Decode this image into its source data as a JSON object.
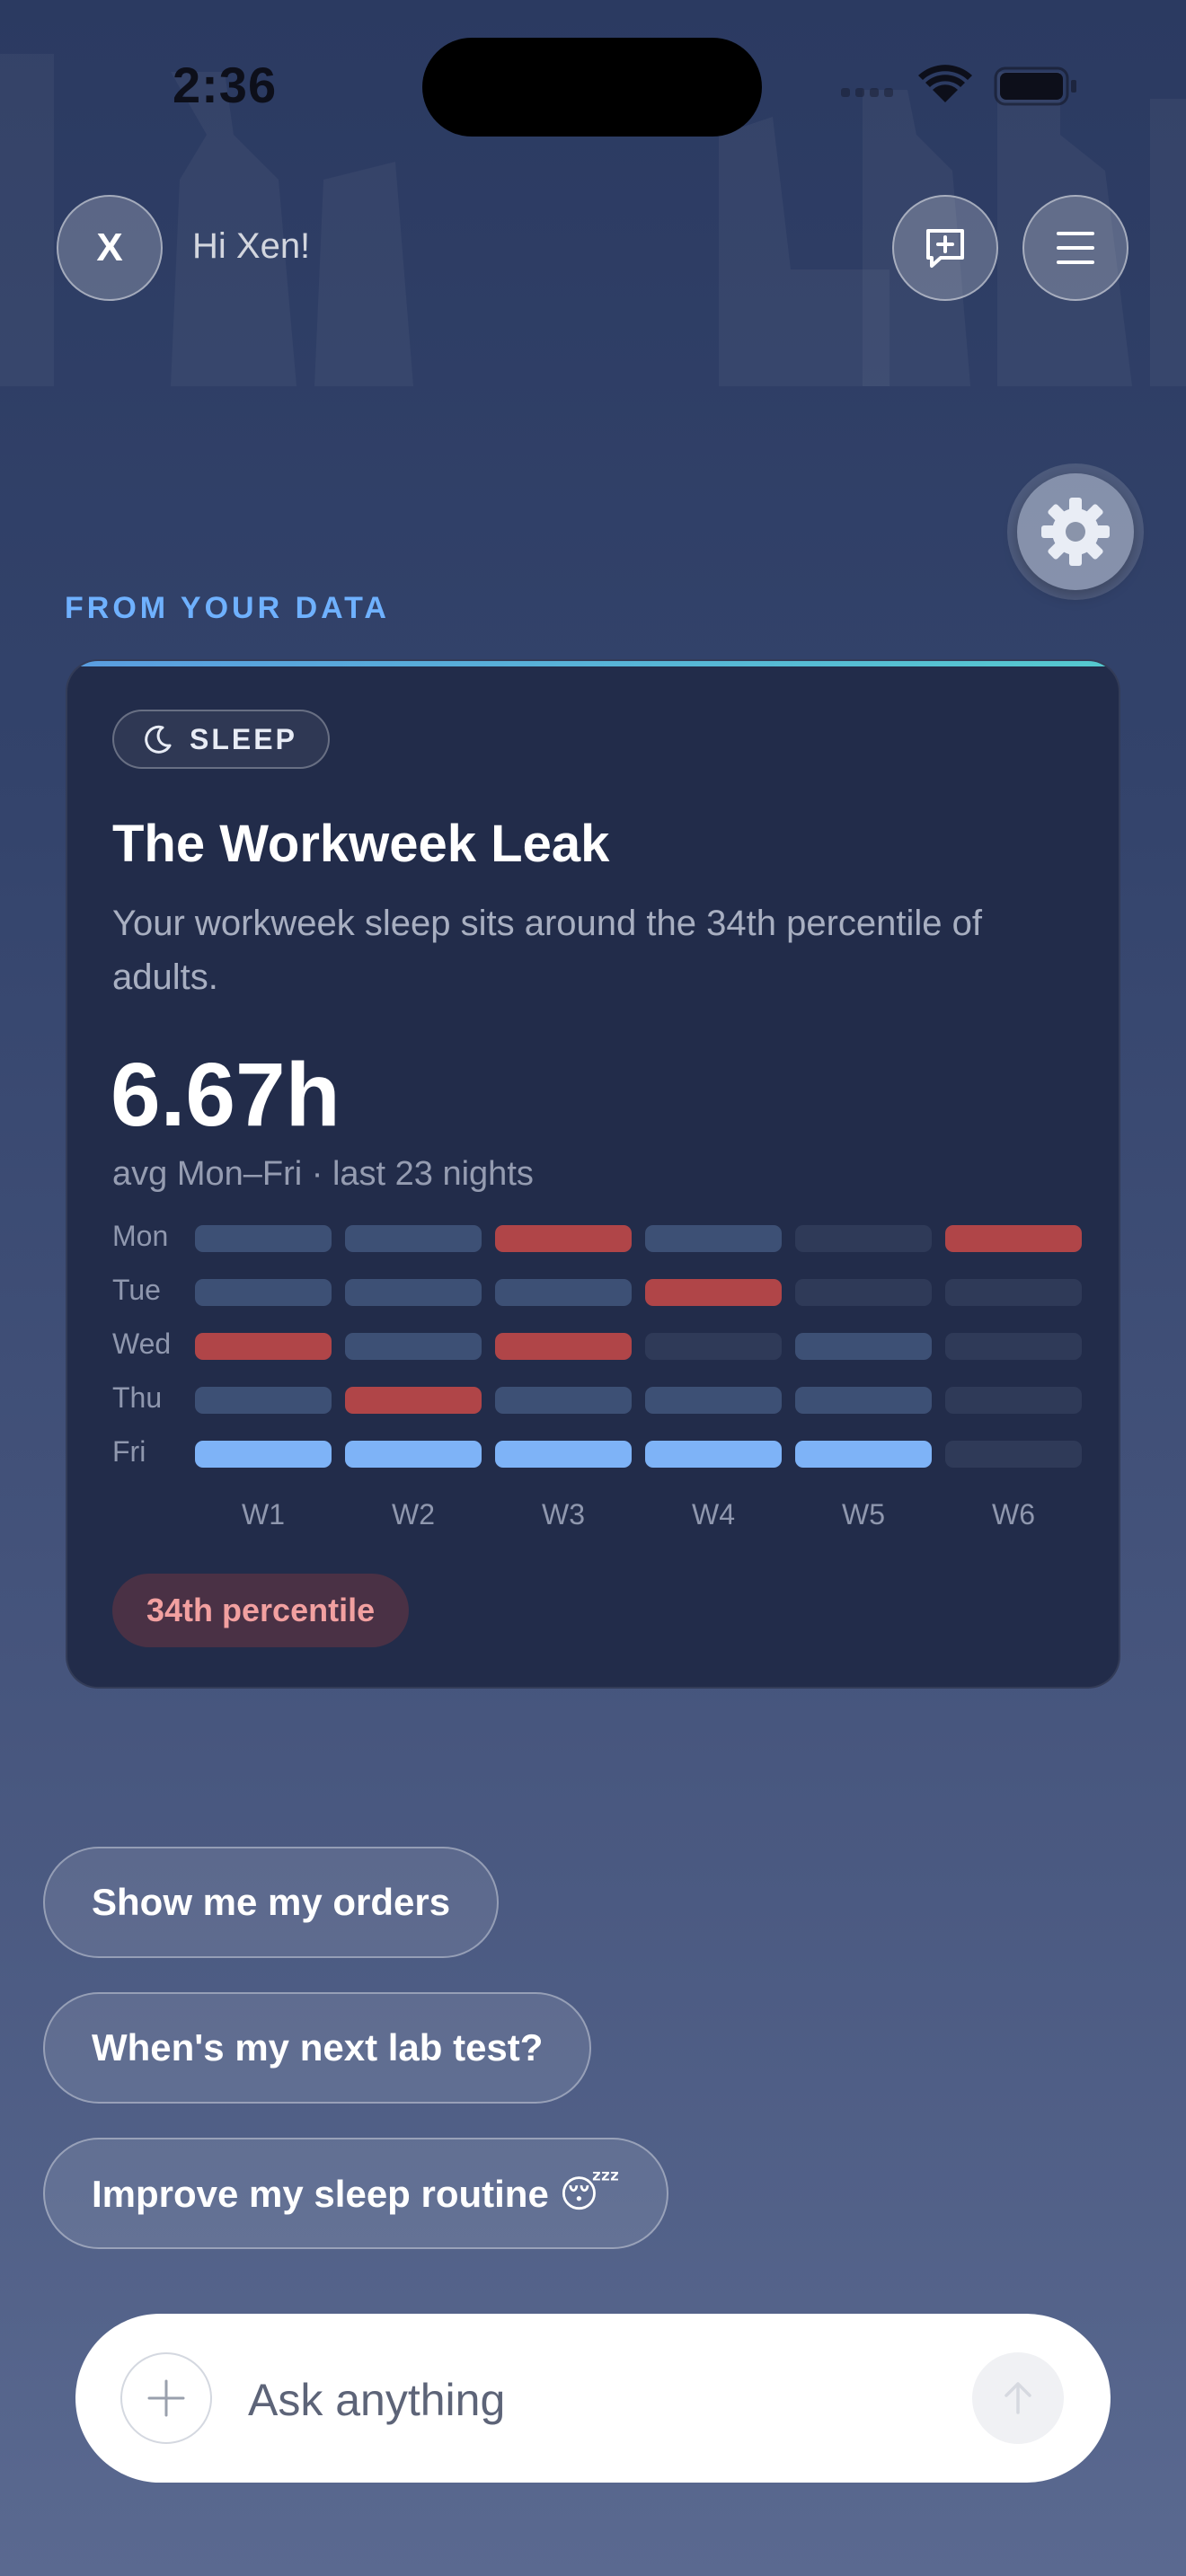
{
  "status_bar": {
    "time": "2:36"
  },
  "header": {
    "avatar_initial": "X",
    "greeting": "Hi Xen!"
  },
  "icons": {
    "new_chat": "chat-plus-icon",
    "menu": "hamburger-menu-icon",
    "settings": "gear-icon",
    "sleep": "moon-icon",
    "add": "plus-icon",
    "send": "arrow-up-icon"
  },
  "section_label": "FROM YOUR DATA",
  "card": {
    "chip_label": "SLEEP",
    "title": "The Workweek Leak",
    "description": "Your workweek sleep sits around the 34th percentile of adults.",
    "metric": "6.67h",
    "metric_caption": "avg Mon–Fri · last 23 nights",
    "percentile_badge": "34th percentile",
    "grid": {
      "days": [
        "Mon",
        "Tue",
        "Wed",
        "Thu",
        "Fri"
      ],
      "weeks": [
        "W1",
        "W2",
        "W3",
        "W4",
        "W5",
        "W6"
      ],
      "cells": [
        [
          "normal",
          "normal",
          "low",
          "normal",
          "empty",
          "low"
        ],
        [
          "normal",
          "normal",
          "normal",
          "low",
          "empty",
          "empty"
        ],
        [
          "low",
          "normal",
          "low",
          "empty",
          "normal",
          "empty"
        ],
        [
          "normal",
          "low",
          "normal",
          "normal",
          "normal",
          "empty"
        ],
        [
          "good",
          "good",
          "good",
          "good",
          "good",
          "empty"
        ]
      ],
      "colors": {
        "normal": "#3d5075",
        "low": "#b04548",
        "good": "#7eb3f7",
        "empty": "#2f3a58"
      }
    }
  },
  "suggestions": [
    "Show me my orders",
    "When's my next lab test?",
    "Improve my sleep routine 😴"
  ],
  "input": {
    "placeholder": "Ask anything"
  },
  "colors": {
    "accent": "#6fb1ff",
    "card_bg": "#222c4a",
    "badge_text": "#f2a0a0",
    "badge_bg": "#4a3145"
  }
}
